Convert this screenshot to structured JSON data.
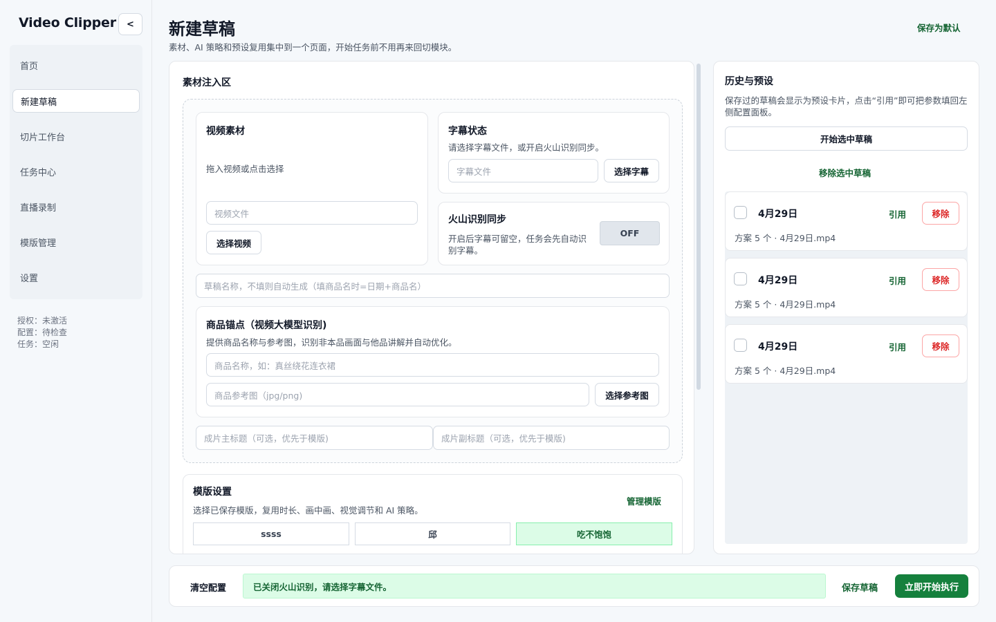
{
  "sidebar": {
    "brand": "Video Clipper",
    "collapse_label": "<",
    "items": [
      {
        "label": "首页"
      },
      {
        "label": "新建草稿"
      },
      {
        "label": "切片工作台"
      },
      {
        "label": "任务中心"
      },
      {
        "label": "直播录制"
      },
      {
        "label": "模版管理"
      },
      {
        "label": "设置"
      }
    ],
    "active_index": 1,
    "status": {
      "license": "授权：未激活",
      "config": "配置：待检查",
      "task": "任务：空闲"
    }
  },
  "header": {
    "title": "新建草稿",
    "subtitle": "素材、AI 策略和预设复用集中到一个页面，开始任务前不用再来回切模块。",
    "save_default": "保存为默认"
  },
  "inject": {
    "section_title": "素材注入区",
    "video": {
      "title": "视频素材",
      "drop_hint": "拖入视频或点击选择",
      "file_placeholder": "视频文件",
      "select_button": "选择视频"
    },
    "subtitle": {
      "title": "字幕状态",
      "desc": "请选择字幕文件，或开启火山识别同步。",
      "file_placeholder": "字幕文件",
      "select_button": "选择字幕"
    },
    "volcano": {
      "title": "火山识别同步",
      "desc": "开启后字幕可留空，任务会先自动识别字幕。",
      "toggle_label": "OFF"
    },
    "draft_name_placeholder": "草稿名称，不填则自动生成（填商品名时=日期+商品名）",
    "product": {
      "title": "商品锚点（视频大模型识别)",
      "desc": "提供商品名称与参考图，识别非本品画面与他品讲解并自动优化。",
      "name_placeholder": "商品名称，如：真丝绕花连衣裙",
      "ref_placeholder": "商品参考图（jpg/png)",
      "select_ref_button": "选择参考图"
    },
    "main_title_placeholder": "成片主标题（可选，优先于模版)",
    "sub_title_placeholder": "成片副标题（可选，优先于模版)"
  },
  "template": {
    "title": "模版设置",
    "desc": "选择已保存模版，复用时长、画中画、视觉调节和 AI 策略。",
    "manage_link": "管理模版",
    "options": [
      {
        "label": "ssss",
        "selected": false
      },
      {
        "label": "邱",
        "selected": false
      },
      {
        "label": "吃不饱饱",
        "selected": true
      }
    ]
  },
  "history": {
    "title": "历史与预设",
    "desc": "保存过的草稿会显示为预设卡片，点击“引用”即可把参数填回左侧配置面板。",
    "start_selected": "开始选中草稿",
    "remove_selected": "移除选中草稿",
    "cite_label": "引用",
    "remove_label": "移除",
    "items": [
      {
        "title": "4月29日",
        "meta": "方案 5 个 · 4月29日.mp4"
      },
      {
        "title": "4月29日",
        "meta": "方案 5 个 · 4月29日.mp4"
      },
      {
        "title": "4月29日",
        "meta": "方案 5 个 · 4月29日.mp4"
      }
    ]
  },
  "footer": {
    "clear": "清空配置",
    "notice": "已关闭火山识别，请选择字幕文件。",
    "save_draft": "保存草稿",
    "run": "立即开始执行"
  },
  "colors": {
    "accent": "#15803d",
    "accent_text": "#166534",
    "success_bg": "#dcfce7",
    "danger": "#dc2626"
  }
}
